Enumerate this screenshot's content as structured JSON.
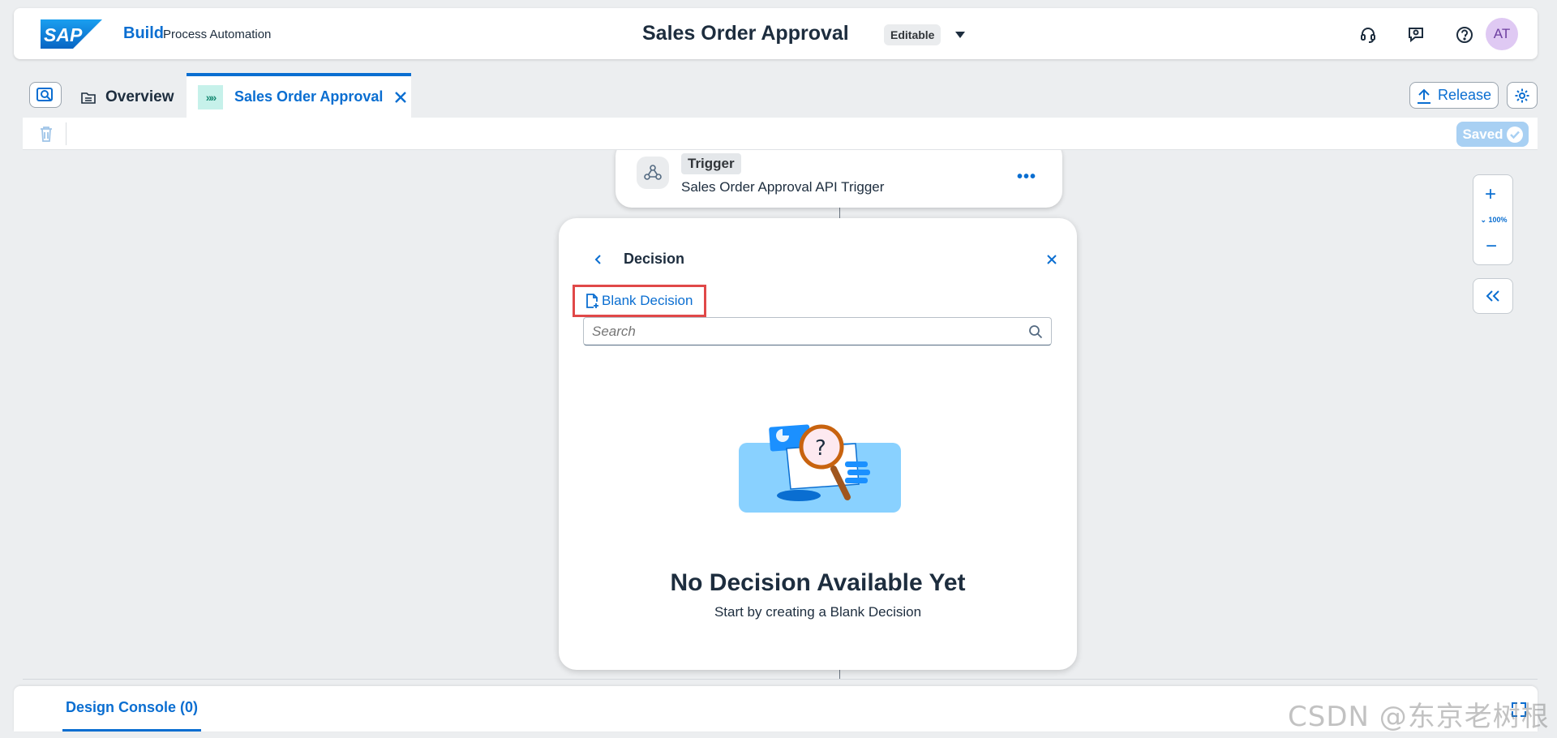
{
  "shellbar": {
    "logo_text": "SAP",
    "product": "Build",
    "product_sub": "Process Automation",
    "app_title": "Sales Order Approval",
    "status_badge": "Editable",
    "avatar_initials": "AT",
    "icons": [
      "headset-icon",
      "feedback-icon",
      "help-icon"
    ]
  },
  "tabs": {
    "overview_label": "Overview",
    "active_label": "Sales Order Approval",
    "active_badge": "»»",
    "release_label": "Release"
  },
  "toolbar": {
    "saved_label": "Saved"
  },
  "canvas": {
    "trigger": {
      "tag": "Trigger",
      "name": "Sales Order Approval API Trigger",
      "more": "•••"
    },
    "decision_panel": {
      "title": "Decision",
      "blank_decision_label": "Blank Decision",
      "search_placeholder": "Search",
      "empty_title": "No Decision Available Yet",
      "empty_subtitle": "Start by creating a Blank Decision"
    },
    "zoom": {
      "level": "100%"
    }
  },
  "console": {
    "tab_label": "Design Console (0)"
  },
  "watermark": "CSDN @东京老树根",
  "colors": {
    "accent": "#0a6ed1",
    "highlight_border": "#e04848",
    "saved_button": "#a8d0f3"
  }
}
